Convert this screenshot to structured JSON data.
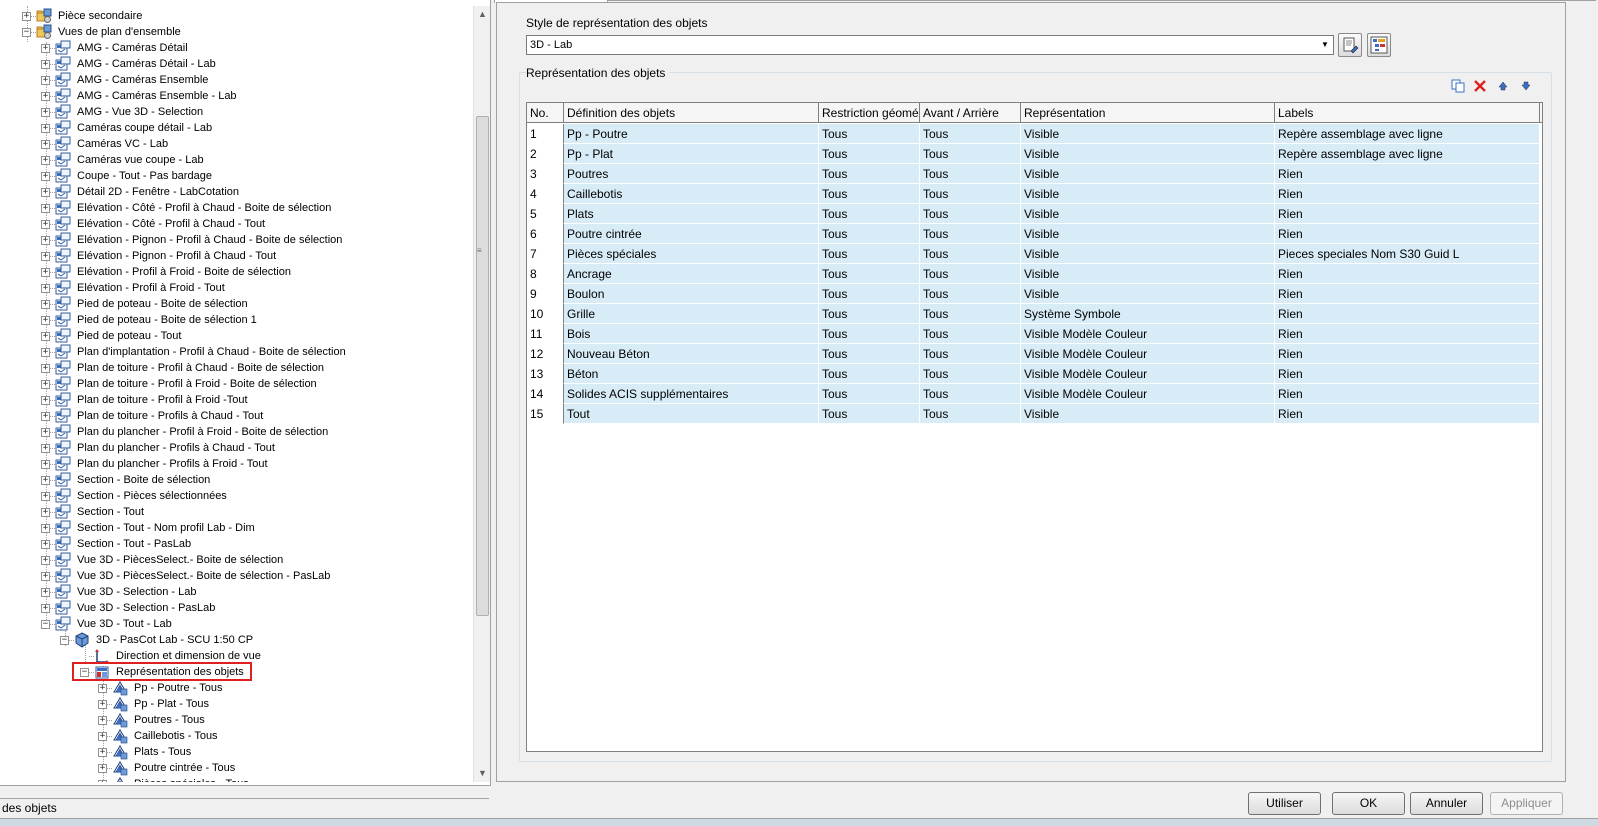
{
  "tree": {
    "items": [
      {
        "label": "Pièce secondaire",
        "level": 1,
        "exp": "+",
        "icon": "folder-gear-icon"
      },
      {
        "label": "Vues de plan d'ensemble",
        "level": 1,
        "exp": "-",
        "icon": "folder-gear-icon"
      },
      {
        "label": "AMG - Caméras Détail",
        "level": 2,
        "exp": "+",
        "icon": "view-style-icon"
      },
      {
        "label": "AMG - Caméras Détail - Lab",
        "level": 2,
        "exp": "+",
        "icon": "view-style-icon"
      },
      {
        "label": "AMG - Caméras Ensemble",
        "level": 2,
        "exp": "+",
        "icon": "view-style-icon"
      },
      {
        "label": "AMG - Caméras Ensemble - Lab",
        "level": 2,
        "exp": "+",
        "icon": "view-style-icon"
      },
      {
        "label": "AMG - Vue 3D - Selection",
        "level": 2,
        "exp": "+",
        "icon": "view-style-icon"
      },
      {
        "label": "Caméras coupe détail - Lab",
        "level": 2,
        "exp": "+",
        "icon": "view-style-icon"
      },
      {
        "label": "Caméras VC - Lab",
        "level": 2,
        "exp": "+",
        "icon": "view-style-icon"
      },
      {
        "label": "Caméras vue coupe - Lab",
        "level": 2,
        "exp": "+",
        "icon": "view-style-icon"
      },
      {
        "label": "Coupe - Tout - Pas bardage",
        "level": 2,
        "exp": "+",
        "icon": "view-style-icon"
      },
      {
        "label": "Détail 2D - Fenêtre - LabCotation",
        "level": 2,
        "exp": "+",
        "icon": "view-style-icon"
      },
      {
        "label": "Elévation - Côté - Profil à Chaud - Boite de sélection",
        "level": 2,
        "exp": "+",
        "icon": "view-style-icon"
      },
      {
        "label": "Elévation - Côté - Profil à Chaud - Tout",
        "level": 2,
        "exp": "+",
        "icon": "view-style-icon"
      },
      {
        "label": "Elévation - Pignon - Profil à Chaud - Boite de sélection",
        "level": 2,
        "exp": "+",
        "icon": "view-style-icon"
      },
      {
        "label": "Elévation - Pignon - Profil à Chaud - Tout",
        "level": 2,
        "exp": "+",
        "icon": "view-style-icon"
      },
      {
        "label": "Elévation - Profil à Froid - Boite de sélection",
        "level": 2,
        "exp": "+",
        "icon": "view-style-icon"
      },
      {
        "label": "Elévation - Profil à Froid - Tout",
        "level": 2,
        "exp": "+",
        "icon": "view-style-icon"
      },
      {
        "label": "Pied de poteau - Boite de sélection",
        "level": 2,
        "exp": "+",
        "icon": "view-style-icon"
      },
      {
        "label": "Pied de poteau - Boite de sélection 1",
        "level": 2,
        "exp": "+",
        "icon": "view-style-icon"
      },
      {
        "label": "Pied de poteau - Tout",
        "level": 2,
        "exp": "+",
        "icon": "view-style-icon"
      },
      {
        "label": "Plan d'implantation - Profil à Chaud - Boite de sélection",
        "level": 2,
        "exp": "+",
        "icon": "view-style-icon"
      },
      {
        "label": "Plan de toiture - Profil à Chaud - Boite de sélection",
        "level": 2,
        "exp": "+",
        "icon": "view-style-icon"
      },
      {
        "label": "Plan de toiture - Profil à Froid - Boite de sélection",
        "level": 2,
        "exp": "+",
        "icon": "view-style-icon"
      },
      {
        "label": "Plan de toiture - Profil à Froid -Tout",
        "level": 2,
        "exp": "+",
        "icon": "view-style-icon"
      },
      {
        "label": "Plan de toiture - Profils à Chaud - Tout",
        "level": 2,
        "exp": "+",
        "icon": "view-style-icon"
      },
      {
        "label": "Plan du plancher - Profil à Froid - Boite de sélection",
        "level": 2,
        "exp": "+",
        "icon": "view-style-icon"
      },
      {
        "label": "Plan du plancher - Profils à Chaud - Tout",
        "level": 2,
        "exp": "+",
        "icon": "view-style-icon"
      },
      {
        "label": "Plan du plancher - Profils à Froid - Tout",
        "level": 2,
        "exp": "+",
        "icon": "view-style-icon"
      },
      {
        "label": "Section - Boite de sélection",
        "level": 2,
        "exp": "+",
        "icon": "view-style-icon"
      },
      {
        "label": "Section - Pièces sélectionnées",
        "level": 2,
        "exp": "+",
        "icon": "view-style-icon"
      },
      {
        "label": "Section - Tout",
        "level": 2,
        "exp": "+",
        "icon": "view-style-icon"
      },
      {
        "label": "Section - Tout - Nom profil Lab - Dim",
        "level": 2,
        "exp": "+",
        "icon": "view-style-icon"
      },
      {
        "label": "Section - Tout - PasLab",
        "level": 2,
        "exp": "+",
        "icon": "view-style-icon"
      },
      {
        "label": "Vue 3D - PiècesSelect.- Boite de sélection",
        "level": 2,
        "exp": "+",
        "icon": "view-style-icon"
      },
      {
        "label": "Vue 3D - PiècesSelect.- Boite de sélection - PasLab",
        "level": 2,
        "exp": "+",
        "icon": "view-style-icon"
      },
      {
        "label": "Vue 3D - Selection - Lab",
        "level": 2,
        "exp": "+",
        "icon": "view-style-icon"
      },
      {
        "label": "Vue 3D - Selection - PasLab",
        "level": 2,
        "exp": "+",
        "icon": "view-style-icon"
      },
      {
        "label": "Vue 3D - Tout - Lab",
        "level": 2,
        "exp": "-",
        "icon": "view-style-icon"
      },
      {
        "label": "3D - PasCot Lab - SCU 1:50  CP",
        "level": 3,
        "exp": "-",
        "icon": "cube-icon"
      },
      {
        "label": "Direction et dimension de vue",
        "level": 4,
        "exp": "",
        "icon": "direction-icon"
      },
      {
        "label": "Représentation des objets",
        "level": 4,
        "exp": "-",
        "icon": "object-representation-icon"
      },
      {
        "label": "Pp - Poutre - Tous",
        "level": 5,
        "exp": "+",
        "icon": "object-item-icon"
      },
      {
        "label": "Pp - Plat - Tous",
        "level": 5,
        "exp": "+",
        "icon": "object-item-icon"
      },
      {
        "label": "Poutres - Tous",
        "level": 5,
        "exp": "+",
        "icon": "object-item-icon"
      },
      {
        "label": "Caillebotis - Tous",
        "level": 5,
        "exp": "+",
        "icon": "object-item-icon"
      },
      {
        "label": "Plats - Tous",
        "level": 5,
        "exp": "+",
        "icon": "object-item-icon"
      },
      {
        "label": "Poutre cintrée - Tous",
        "level": 5,
        "exp": "+",
        "icon": "object-item-icon"
      },
      {
        "label": "Pièces spéciales - Tous",
        "level": 5,
        "exp": "+",
        "icon": "object-item-icon"
      }
    ],
    "highlighted_index": 41
  },
  "status": {
    "label": "des objets"
  },
  "style_section": {
    "label": "Style de représentation des objets",
    "selected": "3D - Lab"
  },
  "repr_section": {
    "label": "Représentation des objets"
  },
  "table": {
    "columns": [
      "No.",
      "Définition des objets",
      "Restriction géomé",
      "Avant / Arrière",
      "Représentation",
      "Labels"
    ],
    "rows": [
      [
        "1",
        "Pp - Poutre",
        "Tous",
        "Tous",
        "Visible",
        "Repère assemblage avec ligne"
      ],
      [
        "2",
        "Pp - Plat",
        "Tous",
        "Tous",
        "Visible",
        "Repère assemblage avec ligne"
      ],
      [
        "3",
        "Poutres",
        "Tous",
        "Tous",
        "Visible",
        "Rien"
      ],
      [
        "4",
        "Caillebotis",
        "Tous",
        "Tous",
        "Visible",
        "Rien"
      ],
      [
        "5",
        "Plats",
        "Tous",
        "Tous",
        "Visible",
        "Rien"
      ],
      [
        "6",
        "Poutre cintrée",
        "Tous",
        "Tous",
        "Visible",
        "Rien"
      ],
      [
        "7",
        "Pièces spéciales",
        "Tous",
        "Tous",
        "Visible",
        "Pieces speciales Nom S30 Guid L"
      ],
      [
        "8",
        "Ancrage",
        "Tous",
        "Tous",
        "Visible",
        "Rien"
      ],
      [
        "9",
        "Boulon",
        "Tous",
        "Tous",
        "Visible",
        "Rien"
      ],
      [
        "10",
        "Grille",
        "Tous",
        "Tous",
        "Système Symbole",
        "Rien"
      ],
      [
        "11",
        "Bois",
        "Tous",
        "Tous",
        "Visible Modèle Couleur",
        "Rien"
      ],
      [
        "12",
        "Nouveau Béton",
        "Tous",
        "Tous",
        "Visible Modèle Couleur",
        "Rien"
      ],
      [
        "13",
        "Béton",
        "Tous",
        "Tous",
        "Visible Modèle Couleur",
        "Rien"
      ],
      [
        "14",
        "Solides ACIS supplémentaires",
        "Tous",
        "Tous",
        "Visible Modèle Couleur",
        "Rien"
      ],
      [
        "15",
        "Tout",
        "Tous",
        "Tous",
        "Visible",
        "Rien"
      ]
    ]
  },
  "buttons": {
    "use": "Utiliser",
    "ok": "OK",
    "cancel": "Annuler",
    "apply": "Appliquer"
  },
  "colors": {
    "row_background": "#d8ecf8",
    "highlight_border": "#e02020",
    "delete_icon": "#e02020"
  }
}
